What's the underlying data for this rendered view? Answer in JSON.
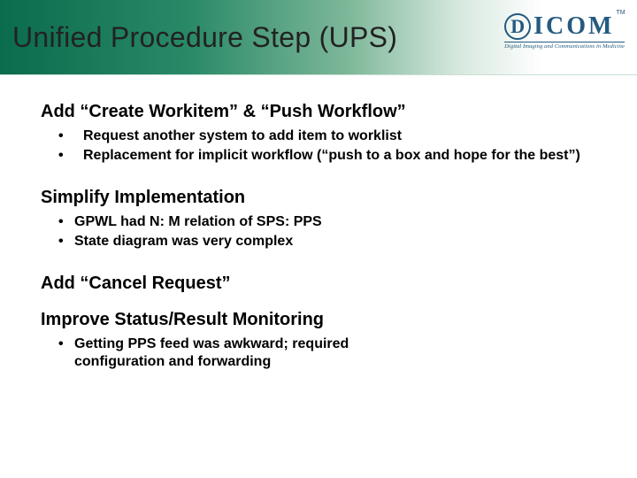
{
  "title": "Unified Procedure Step (UPS)",
  "logo": {
    "d": "D",
    "rest": "ICOM",
    "tm": "TM",
    "tagline": "Digital Imaging and Communications in Medicine"
  },
  "sections": [
    {
      "heading": "Add “Create Workitem” & “Push Workflow”",
      "bullets": [
        "Request another system to add item to worklist",
        "Replacement for implicit workflow (“push to a box and hope for the best”)"
      ],
      "bullet_indent_wide": true
    },
    {
      "heading": "Simplify Implementation",
      "bullets": [
        "GPWL had N: M relation of SPS: PPS",
        "State diagram was very complex"
      ],
      "bullet_indent_wide": false
    },
    {
      "heading": "Add “Cancel Request”",
      "bullets": []
    },
    {
      "heading": "Improve Status/Result Monitoring",
      "bullets": [
        "Getting PPS feed was awkward; required configuration and forwarding"
      ],
      "bullet_indent_wide": false
    }
  ]
}
